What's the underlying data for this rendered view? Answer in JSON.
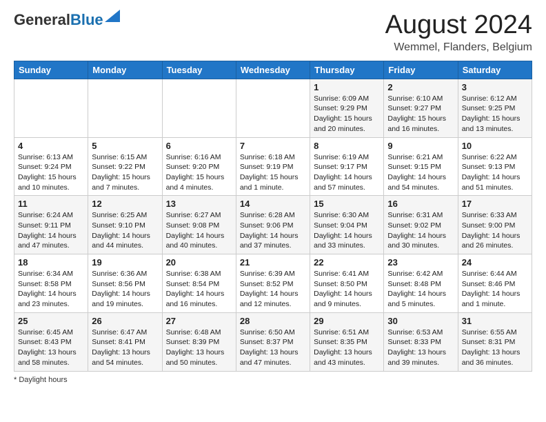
{
  "header": {
    "logo_general": "General",
    "logo_blue": "Blue",
    "month_year": "August 2024",
    "location": "Wemmel, Flanders, Belgium"
  },
  "days_of_week": [
    "Sunday",
    "Monday",
    "Tuesday",
    "Wednesday",
    "Thursday",
    "Friday",
    "Saturday"
  ],
  "footer": {
    "note": "Daylight hours"
  },
  "weeks": [
    [
      {
        "day": "",
        "info": ""
      },
      {
        "day": "",
        "info": ""
      },
      {
        "day": "",
        "info": ""
      },
      {
        "day": "",
        "info": ""
      },
      {
        "day": "1",
        "info": "Sunrise: 6:09 AM\nSunset: 9:29 PM\nDaylight: 15 hours\nand 20 minutes."
      },
      {
        "day": "2",
        "info": "Sunrise: 6:10 AM\nSunset: 9:27 PM\nDaylight: 15 hours\nand 16 minutes."
      },
      {
        "day": "3",
        "info": "Sunrise: 6:12 AM\nSunset: 9:25 PM\nDaylight: 15 hours\nand 13 minutes."
      }
    ],
    [
      {
        "day": "4",
        "info": "Sunrise: 6:13 AM\nSunset: 9:24 PM\nDaylight: 15 hours\nand 10 minutes."
      },
      {
        "day": "5",
        "info": "Sunrise: 6:15 AM\nSunset: 9:22 PM\nDaylight: 15 hours\nand 7 minutes."
      },
      {
        "day": "6",
        "info": "Sunrise: 6:16 AM\nSunset: 9:20 PM\nDaylight: 15 hours\nand 4 minutes."
      },
      {
        "day": "7",
        "info": "Sunrise: 6:18 AM\nSunset: 9:19 PM\nDaylight: 15 hours\nand 1 minute."
      },
      {
        "day": "8",
        "info": "Sunrise: 6:19 AM\nSunset: 9:17 PM\nDaylight: 14 hours\nand 57 minutes."
      },
      {
        "day": "9",
        "info": "Sunrise: 6:21 AM\nSunset: 9:15 PM\nDaylight: 14 hours\nand 54 minutes."
      },
      {
        "day": "10",
        "info": "Sunrise: 6:22 AM\nSunset: 9:13 PM\nDaylight: 14 hours\nand 51 minutes."
      }
    ],
    [
      {
        "day": "11",
        "info": "Sunrise: 6:24 AM\nSunset: 9:11 PM\nDaylight: 14 hours\nand 47 minutes."
      },
      {
        "day": "12",
        "info": "Sunrise: 6:25 AM\nSunset: 9:10 PM\nDaylight: 14 hours\nand 44 minutes."
      },
      {
        "day": "13",
        "info": "Sunrise: 6:27 AM\nSunset: 9:08 PM\nDaylight: 14 hours\nand 40 minutes."
      },
      {
        "day": "14",
        "info": "Sunrise: 6:28 AM\nSunset: 9:06 PM\nDaylight: 14 hours\nand 37 minutes."
      },
      {
        "day": "15",
        "info": "Sunrise: 6:30 AM\nSunset: 9:04 PM\nDaylight: 14 hours\nand 33 minutes."
      },
      {
        "day": "16",
        "info": "Sunrise: 6:31 AM\nSunset: 9:02 PM\nDaylight: 14 hours\nand 30 minutes."
      },
      {
        "day": "17",
        "info": "Sunrise: 6:33 AM\nSunset: 9:00 PM\nDaylight: 14 hours\nand 26 minutes."
      }
    ],
    [
      {
        "day": "18",
        "info": "Sunrise: 6:34 AM\nSunset: 8:58 PM\nDaylight: 14 hours\nand 23 minutes."
      },
      {
        "day": "19",
        "info": "Sunrise: 6:36 AM\nSunset: 8:56 PM\nDaylight: 14 hours\nand 19 minutes."
      },
      {
        "day": "20",
        "info": "Sunrise: 6:38 AM\nSunset: 8:54 PM\nDaylight: 14 hours\nand 16 minutes."
      },
      {
        "day": "21",
        "info": "Sunrise: 6:39 AM\nSunset: 8:52 PM\nDaylight: 14 hours\nand 12 minutes."
      },
      {
        "day": "22",
        "info": "Sunrise: 6:41 AM\nSunset: 8:50 PM\nDaylight: 14 hours\nand 9 minutes."
      },
      {
        "day": "23",
        "info": "Sunrise: 6:42 AM\nSunset: 8:48 PM\nDaylight: 14 hours\nand 5 minutes."
      },
      {
        "day": "24",
        "info": "Sunrise: 6:44 AM\nSunset: 8:46 PM\nDaylight: 14 hours\nand 1 minute."
      }
    ],
    [
      {
        "day": "25",
        "info": "Sunrise: 6:45 AM\nSunset: 8:43 PM\nDaylight: 13 hours\nand 58 minutes."
      },
      {
        "day": "26",
        "info": "Sunrise: 6:47 AM\nSunset: 8:41 PM\nDaylight: 13 hours\nand 54 minutes."
      },
      {
        "day": "27",
        "info": "Sunrise: 6:48 AM\nSunset: 8:39 PM\nDaylight: 13 hours\nand 50 minutes."
      },
      {
        "day": "28",
        "info": "Sunrise: 6:50 AM\nSunset: 8:37 PM\nDaylight: 13 hours\nand 47 minutes."
      },
      {
        "day": "29",
        "info": "Sunrise: 6:51 AM\nSunset: 8:35 PM\nDaylight: 13 hours\nand 43 minutes."
      },
      {
        "day": "30",
        "info": "Sunrise: 6:53 AM\nSunset: 8:33 PM\nDaylight: 13 hours\nand 39 minutes."
      },
      {
        "day": "31",
        "info": "Sunrise: 6:55 AM\nSunset: 8:31 PM\nDaylight: 13 hours\nand 36 minutes."
      }
    ]
  ]
}
